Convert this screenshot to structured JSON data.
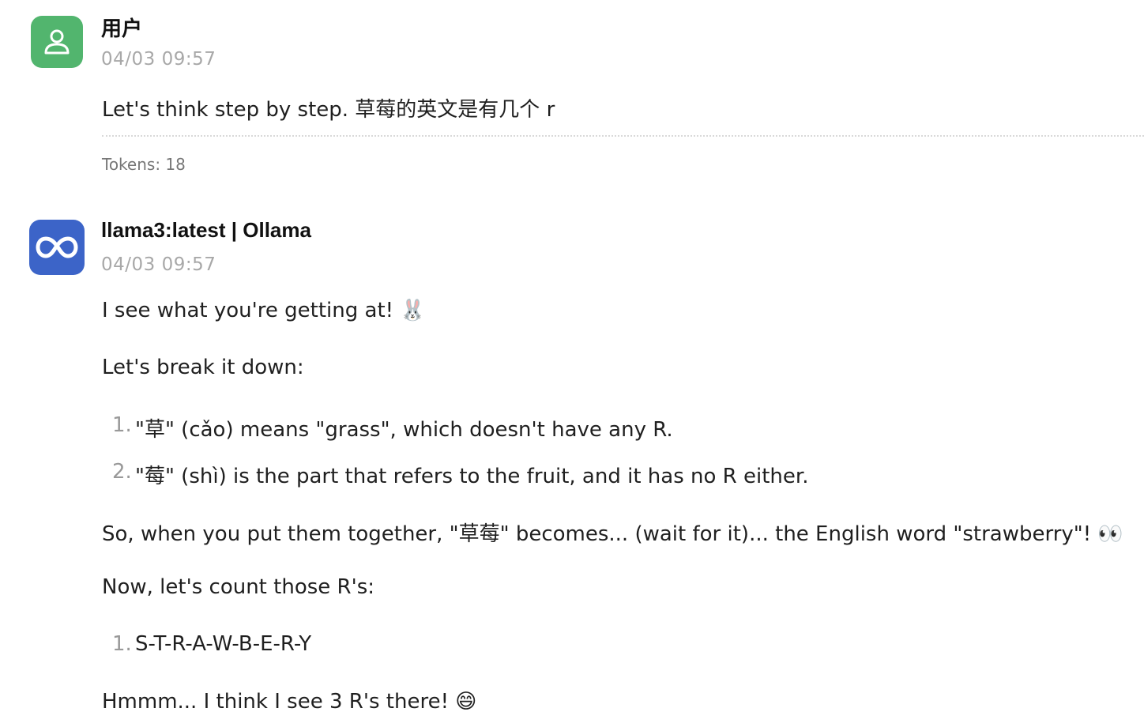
{
  "messages": [
    {
      "author": "用户",
      "time": "04/03 09:57",
      "text": "Let's think step by step. 草莓的英文是有几个 r",
      "tokens": "Tokens: 18",
      "avatar_icon": "user-icon",
      "avatar_color": "#52b56e"
    },
    {
      "author": "llama3:latest | Ollama",
      "time": "04/03 09:57",
      "avatar_icon": "meta-logo-icon",
      "avatar_color": "#3c64c8",
      "paragraphs": [
        "I see what you're getting at! 🐰",
        "Let's break it down:",
        "So, when you put them together, \"草莓\" becomes... (wait for it)... the English word \"strawberry\"! 👀",
        "Now, let's count those R's:",
        "Hmmm... I think I see 3 R's there! 😄"
      ],
      "list1": [
        {
          "num": "1.",
          "text": "\"草\" (cǎo) means \"grass\", which doesn't have any R."
        },
        {
          "num": "2.",
          "text": "\"莓\" (shì) is the part that refers to the fruit, and it has no R either."
        }
      ],
      "list2": [
        {
          "num": "1.",
          "text": "S-T-R-A-W-B-E-R-Y"
        }
      ]
    }
  ]
}
